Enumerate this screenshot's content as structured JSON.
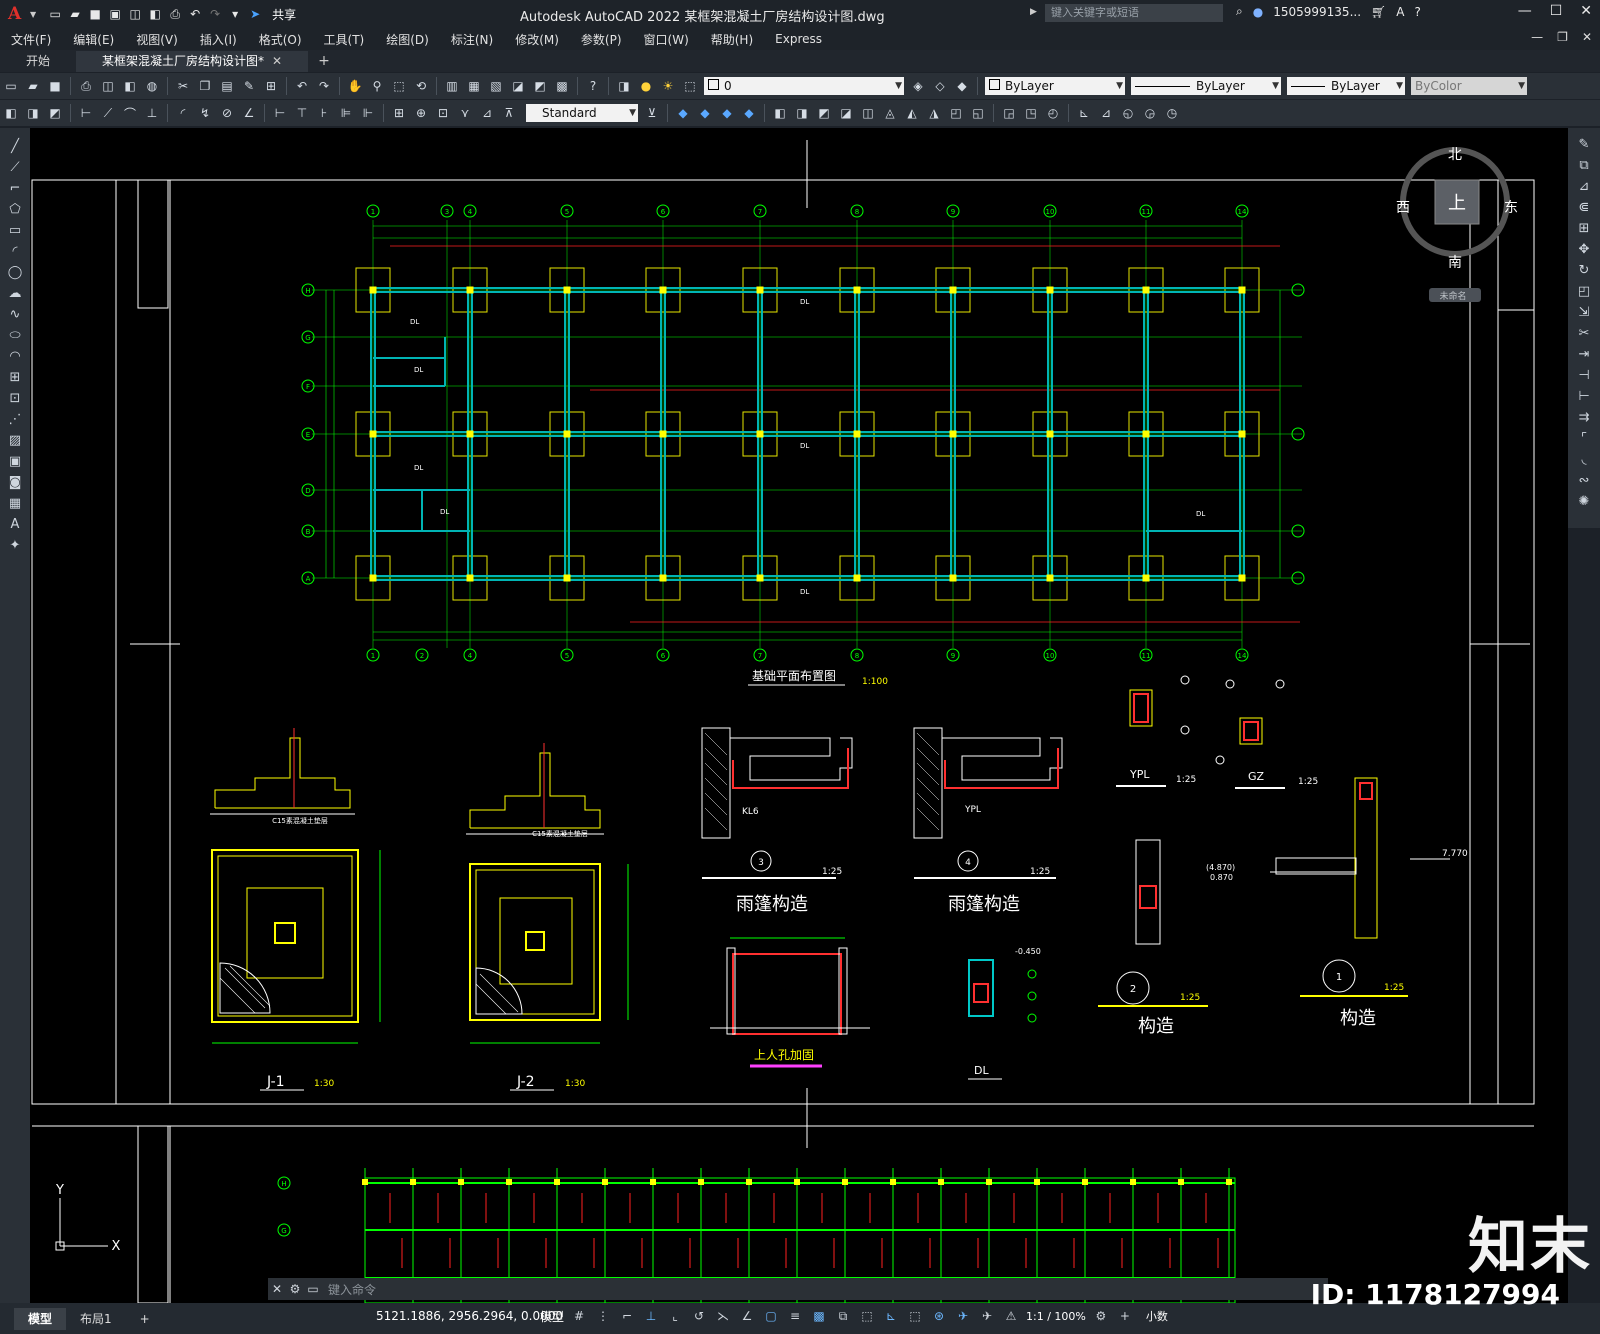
{
  "app": {
    "logo": "A",
    "title": "Autodesk AutoCAD 2022    某框架混凝土厂房结构设计图.dwg",
    "share_label": "共享",
    "search_placeholder": "键入关键字或短语",
    "user": "1505999135...",
    "help": "?"
  },
  "menu": [
    "文件(F)",
    "编辑(E)",
    "视图(V)",
    "插入(I)",
    "格式(O)",
    "工具(T)",
    "绘图(D)",
    "标注(N)",
    "修改(M)",
    "参数(P)",
    "窗口(W)",
    "帮助(H)",
    "Express"
  ],
  "file_tabs": [
    {
      "label": "开始"
    },
    {
      "label": "某框架混凝土厂房结构设计图*"
    }
  ],
  "layer_combo": "0",
  "color_combo": "ByLayer",
  "linetype_combo": "ByLayer",
  "lineweight_combo": "ByLayer",
  "plotstyle_combo": "ByColor",
  "textstyle_combo": "Standard",
  "viewcube": {
    "north": "北",
    "south": "南",
    "east": "东",
    "west": "西",
    "top": "上",
    "wcs": "未命名"
  },
  "drawing": {
    "plan_title": "基础平面布置图",
    "plan_scale": "1:100",
    "axes_top": [
      "1",
      "3",
      "4",
      "5",
      "6",
      "7",
      "8",
      "9",
      "10",
      "11",
      "14"
    ],
    "axes_bottom": [
      "1",
      "2",
      "4",
      "5",
      "6",
      "7",
      "8",
      "9",
      "10",
      "11",
      "14"
    ],
    "axes_side": [
      "H",
      "G",
      "F",
      "E",
      "D",
      "B",
      "A"
    ],
    "beam_label": "DL",
    "details": [
      {
        "label": "J-1",
        "scale": "1:30"
      },
      {
        "label": "J-2",
        "scale": "1:30"
      },
      {
        "label": "雨篷构造",
        "scale": "1:25",
        "num": "3"
      },
      {
        "label": "雨篷构造",
        "scale": "1:25",
        "num": "4"
      },
      {
        "label": "YPL",
        "scale": "1:25"
      },
      {
        "label": "GZ",
        "scale": "1:25"
      },
      {
        "label": "构造",
        "scale": "1:25",
        "num": "2"
      },
      {
        "label": "构造",
        "scale": "1:25",
        "num": "1"
      },
      {
        "label": "上人孔加固"
      },
      {
        "label": "DL"
      }
    ],
    "elev_770": "7.770",
    "elev_4870": "(4.870)",
    "elev_0870": "0.870",
    "c15": "C15素混凝土垫层",
    "kl6": "KL6",
    "ypl2": "YPL",
    "neg_0450": "-0.450"
  },
  "command_placeholder": "键入命令",
  "status": {
    "tabs": [
      "模型",
      "布局1"
    ],
    "coords": "5121.1886, 2956.2964, 0.0000",
    "model": "模型",
    "scale": "1:1 / 100%",
    "units": "小数"
  },
  "watermark": {
    "brand": "知末",
    "id": "ID: 1178127994"
  },
  "colors": {
    "canvas": "#000000",
    "axis_green": "#00ff00",
    "beam_cyan": "#00b4b4",
    "footing_yellow": "#e6e600",
    "column_yellow": "#ffff00",
    "red": "#ff0000",
    "white": "#ffffff"
  }
}
